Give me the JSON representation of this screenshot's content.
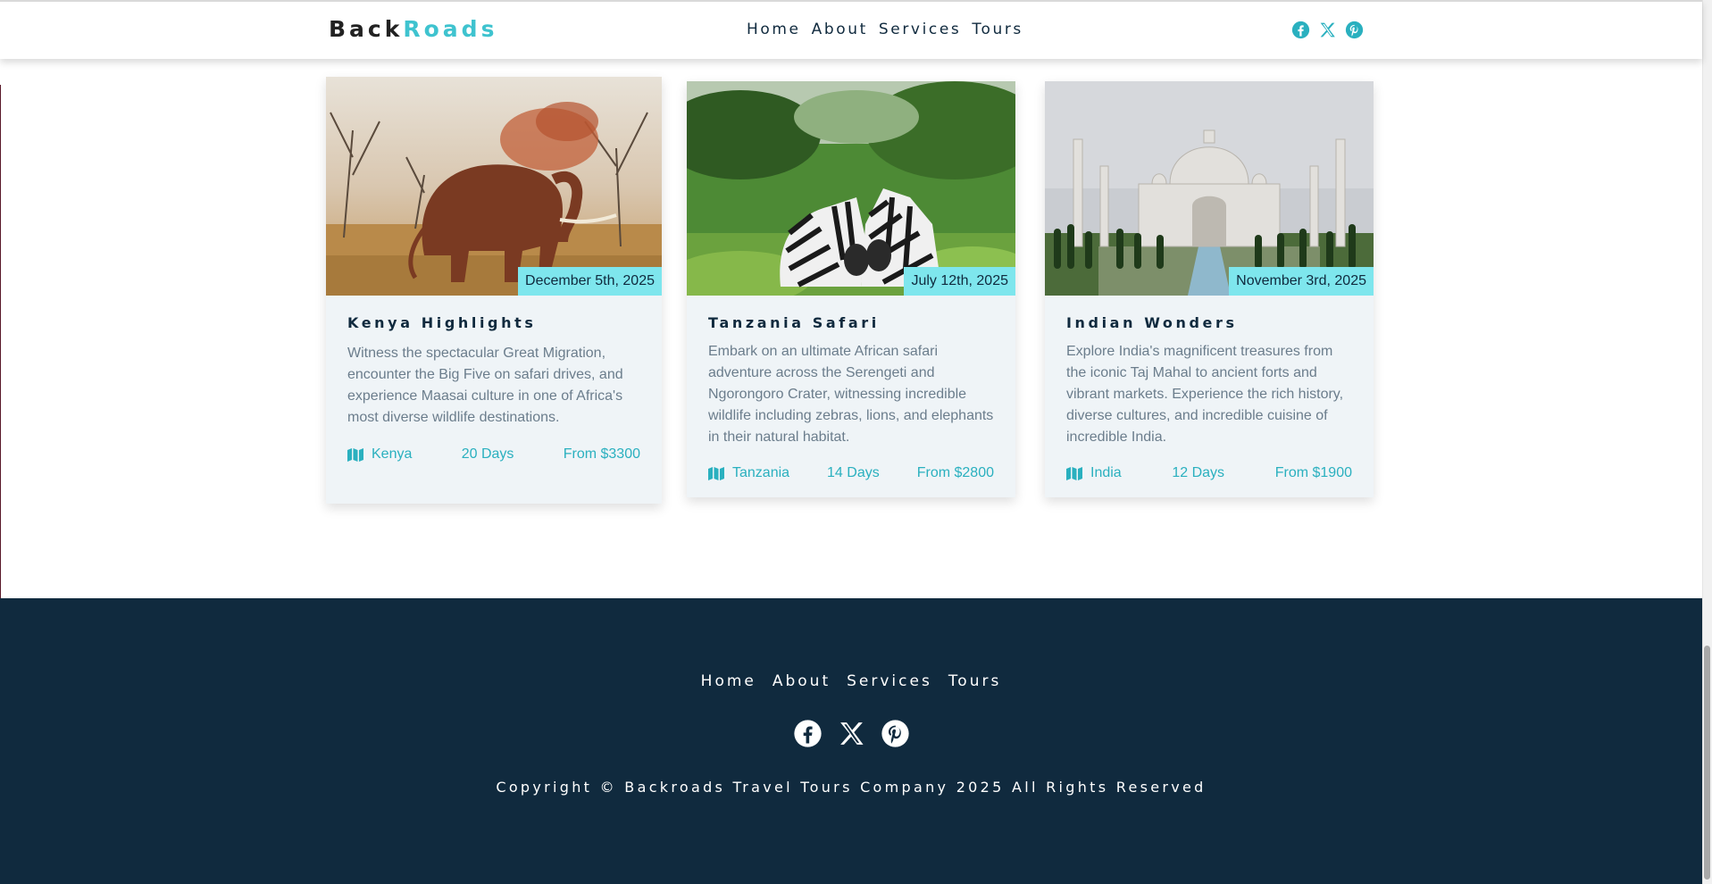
{
  "navbar": {
    "brand_part1": "Back",
    "brand_part2": "Roads",
    "links": [
      "Home",
      "About",
      "Services",
      "Tours"
    ],
    "social_icons": [
      "facebook-icon",
      "x-icon",
      "pinterest-icon"
    ]
  },
  "tours": [
    {
      "date": "December 5th, 2025",
      "title": "Kenya Highlights",
      "description": "Witness the spectacular Great Migration, encounter the Big Five on safari drives, and experience Maasai culture in one of Africa's most diverse wildlife destinations.",
      "location": "Kenya",
      "duration": "20 Days",
      "price": "From $3300",
      "image": "elephant-photo"
    },
    {
      "date": "July 12th, 2025",
      "title": "Tanzania Safari",
      "description": "Embark on an ultimate African safari adventure across the Serengeti and Ngorongoro Crater, witnessing incredible wildlife including zebras, lions, and elephants in their natural habitat.",
      "location": "Tanzania",
      "duration": "14 Days",
      "price": "From $2800",
      "image": "zebras-photo"
    },
    {
      "date": "November 3rd, 2025",
      "title": "Indian Wonders",
      "description": "Explore India's magnificent treasures from the iconic Taj Mahal to ancient forts and vibrant markets. Experience the rich history, diverse cultures, and incredible cuisine of incredible India.",
      "location": "India",
      "duration": "12 Days",
      "price": "From $1900",
      "image": "taj-mahal-photo"
    }
  ],
  "footer": {
    "links": [
      "Home",
      "About",
      "Services",
      "Tours"
    ],
    "social_icons": [
      "facebook-icon",
      "x-icon",
      "pinterest-icon"
    ],
    "copyright": "Copyright © Backroads Travel Tours Company 2025 All Rights Reserved"
  },
  "colors": {
    "accent": "#3fc3cf",
    "badge": "#7ee6ed",
    "dark": "#102a3e",
    "card_bg": "#eff4f7"
  }
}
